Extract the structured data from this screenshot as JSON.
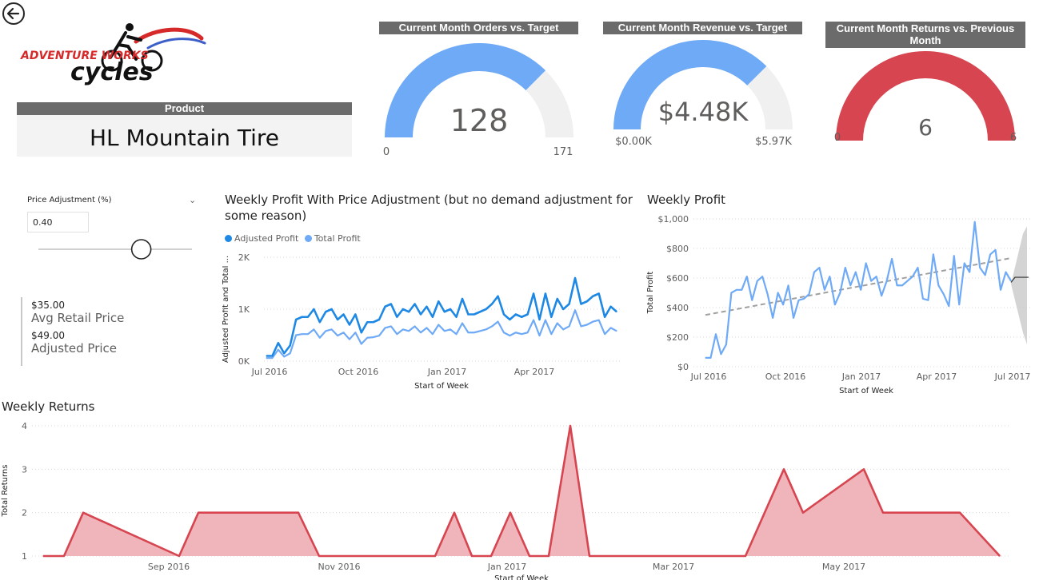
{
  "product": {
    "header": "Product",
    "name": "HL Mountain Tire"
  },
  "gauges": [
    {
      "title": "Current Month Orders vs. Target",
      "value": 128,
      "display": "128",
      "min_label": "0",
      "max_label": "171",
      "min": 0,
      "max": 171,
      "color": "#6FAAF7"
    },
    {
      "title": "Current Month Revenue vs. Target",
      "value": 4.48,
      "display": "$4.48K",
      "min_label": "$0.00K",
      "max_label": "$5.97K",
      "min": 0,
      "max": 5.97,
      "color": "#6FAAF7"
    },
    {
      "title": "Current Month Returns vs. Previous Month",
      "value": 6,
      "display": "6",
      "min_label": "0",
      "max_label": "6",
      "min": 0,
      "max": 6,
      "color": "#D64550"
    }
  ],
  "slicer": {
    "label": "Price Adjustment (%)",
    "value": "0.40",
    "level": 0.67
  },
  "cards": {
    "avg_retail_value": "$35.00",
    "avg_retail_label": "Avg Retail Price",
    "adjusted_value": "$49.00",
    "adjusted_label": "Adjusted Price"
  },
  "colors": {
    "adjusted": "#1E88E5",
    "total": "#6FAAF7",
    "returns_line": "#D64550",
    "returns_fill": "#EFB5BA",
    "gauge_track": "#F0F0F0",
    "header_bg": "#6B6B6B"
  },
  "chart_data": [
    {
      "type": "line",
      "title": "Weekly Profit With Price Adjustment (but no demand adjustment for some reason)",
      "xlabel": "Start of Week",
      "ylabel": "Adjusted Profit and Total ...",
      "ylim": [
        0,
        2000
      ],
      "yticks": [
        "0K",
        "1K",
        "2K"
      ],
      "xticks": [
        "Jul 2016",
        "Oct 2016",
        "Jan 2017",
        "Apr 2017"
      ],
      "legend": "top-left",
      "grid": true,
      "series": [
        {
          "name": "Adjusted Profit",
          "values": [
            100,
            100,
            350,
            150,
            300,
            800,
            850,
            850,
            1000,
            750,
            950,
            1000,
            800,
            900,
            700,
            900,
            550,
            750,
            750,
            800,
            1050,
            1100,
            850,
            1000,
            950,
            1100,
            900,
            1050,
            850,
            1150,
            950,
            1000,
            850,
            1200,
            900,
            900,
            950,
            1000,
            1100,
            1250,
            900,
            800,
            900,
            850,
            900,
            1300,
            800,
            1300,
            850,
            1200,
            1000,
            1100,
            1600,
            1100,
            1150,
            1250,
            1300,
            850,
            1050,
            950
          ]
        },
        {
          "name": "Total Profit",
          "values": [
            60,
            60,
            220,
            85,
            150,
            500,
            520,
            520,
            610,
            450,
            580,
            610,
            490,
            550,
            420,
            550,
            330,
            450,
            460,
            490,
            640,
            670,
            520,
            610,
            580,
            670,
            550,
            640,
            520,
            700,
            580,
            610,
            520,
            730,
            550,
            550,
            580,
            610,
            670,
            760,
            550,
            490,
            550,
            520,
            550,
            790,
            490,
            790,
            520,
            730,
            610,
            670,
            980,
            670,
            700,
            760,
            790,
            520,
            640,
            580
          ]
        }
      ]
    },
    {
      "type": "line",
      "title": "Weekly Profit",
      "xlabel": "Start of Week",
      "ylabel": "Total Profit",
      "ylim": [
        0,
        1000
      ],
      "yticks": [
        "$0",
        "$200",
        "$400",
        "$600",
        "$800",
        "$1,000"
      ],
      "xticks": [
        "Jul 2016",
        "Oct 2016",
        "Jan 2017",
        "Apr 2017",
        "Jul 2017"
      ],
      "grid": true,
      "trend_line": true,
      "forecast": true,
      "series": [
        {
          "name": "Total Profit",
          "values": [
            60,
            60,
            220,
            85,
            150,
            500,
            520,
            520,
            610,
            450,
            580,
            610,
            490,
            330,
            500,
            420,
            550,
            330,
            450,
            460,
            490,
            640,
            670,
            520,
            610,
            420,
            500,
            670,
            550,
            640,
            520,
            700,
            580,
            610,
            480,
            580,
            730,
            550,
            550,
            580,
            610,
            670,
            460,
            450,
            760,
            550,
            490,
            410,
            750,
            420,
            700,
            640,
            980,
            670,
            620,
            760,
            790,
            520,
            640,
            580
          ]
        }
      ]
    },
    {
      "type": "area",
      "title": "Weekly Returns",
      "xlabel": "Start of Week",
      "ylabel": "Total Returns",
      "ylim": [
        1,
        4
      ],
      "yticks": [
        "1",
        "2",
        "3",
        "4"
      ],
      "xticks": [
        "Sep 2016",
        "Nov 2016",
        "Jan 2017",
        "Mar 2017",
        "May 2017"
      ],
      "grid": true,
      "series": [
        {
          "name": "Total Returns",
          "values": [
            1,
            1,
            2,
            1,
            2,
            2,
            1,
            1,
            1,
            2,
            1,
            1,
            2,
            1,
            1,
            4,
            1,
            1,
            1,
            1,
            1,
            1,
            3,
            2,
            3,
            2,
            2,
            2,
            1
          ]
        }
      ]
    }
  ]
}
